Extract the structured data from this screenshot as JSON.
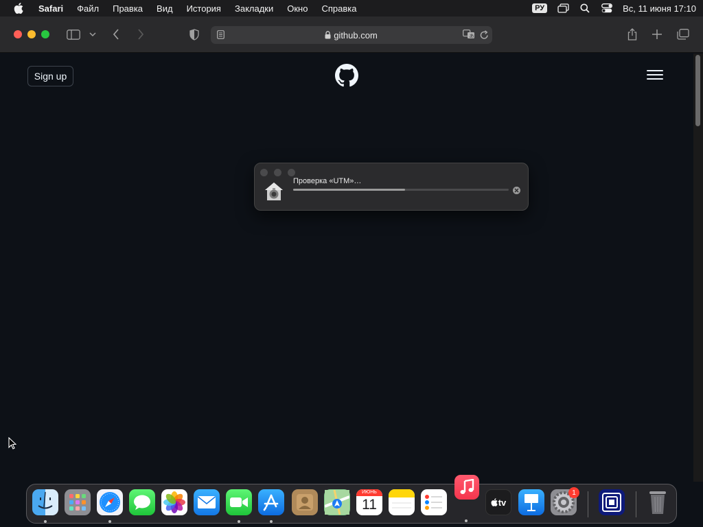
{
  "menubar": {
    "app_name": "Safari",
    "items": [
      "Файл",
      "Правка",
      "Вид",
      "История",
      "Закладки",
      "Окно",
      "Справка"
    ],
    "input_source": "РУ",
    "clock": "Вс, 11 июня  17:10"
  },
  "browser": {
    "url": "github.com"
  },
  "page": {
    "signup_label": "Sign up"
  },
  "dialog": {
    "title": "Проверка «UTM»…",
    "progress": 0.52
  },
  "dock": {
    "apps": [
      "finder",
      "launchpad",
      "safari",
      "messages",
      "photos",
      "mail",
      "facetime",
      "app-store",
      "contacts",
      "maps",
      "calendar",
      "notes",
      "reminders",
      "music",
      "apple-tv",
      "keynote",
      "system-settings",
      "utm",
      "trash"
    ],
    "calendar_month": "ИЮНЬ",
    "calendar_day": "11",
    "settings_badge": "1",
    "tv_label": "tv"
  }
}
